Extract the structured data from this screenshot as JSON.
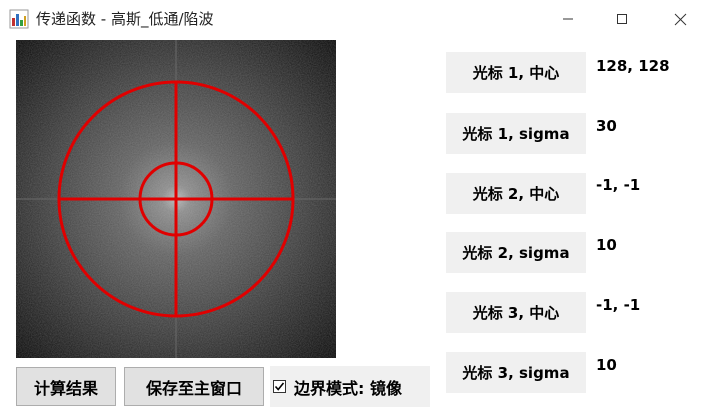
{
  "window": {
    "title": "传递函数 - 高斯_低通/陷波",
    "app_icon": "chart-app-icon",
    "controls": [
      "minimize-icon",
      "maximize-icon",
      "close-icon"
    ]
  },
  "preview": {
    "description_icon": "fft-spectrum-image",
    "overlay_color": "#e00000"
  },
  "params": [
    {
      "label": "光标 1, 中心",
      "value": "128, 128"
    },
    {
      "label": "光标 1, sigma",
      "value": "30"
    },
    {
      "label": "光标 2, 中心",
      "value": "-1, -1"
    },
    {
      "label": "光标 2, sigma",
      "value": "10"
    },
    {
      "label": "光标 3, 中心",
      "value": "-1, -1"
    },
    {
      "label": "光标 3, sigma",
      "value": "10"
    }
  ],
  "buttons": {
    "compute": "计算结果",
    "save": "保存至主窗口"
  },
  "border_mode": {
    "label": "边界模式: 镜像",
    "checked": true
  }
}
